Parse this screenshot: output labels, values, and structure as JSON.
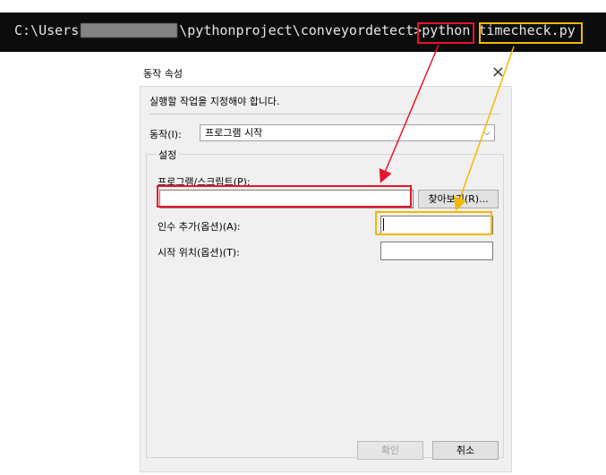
{
  "terminal": {
    "prefix": "C:\\Users",
    "path": "\\pythonproject\\conveyordetect>",
    "command": "python",
    "argument": "timecheck.py"
  },
  "dialog": {
    "title": "동작 속성",
    "close_glyph": "×",
    "instruction": "실행할 작업을 지정해야 합니다.",
    "action_label": "동작(I):",
    "action_value": "프로그램 시작",
    "settings_group": "설정",
    "program_label": "프로그램/스크립트(P):",
    "program_value": "",
    "browse_label": "찾아보기(R)...",
    "args_label": "인수 추가(옵션)(A):",
    "args_value": "",
    "startin_label": "시작 위치(옵션)(T):",
    "startin_value": "",
    "ok_label": "확인",
    "cancel_label": "취소"
  },
  "colors": {
    "highlight_red": "#e8142a",
    "highlight_yellow": "#f5b800",
    "terminal_bg": "#0c0c0c"
  }
}
